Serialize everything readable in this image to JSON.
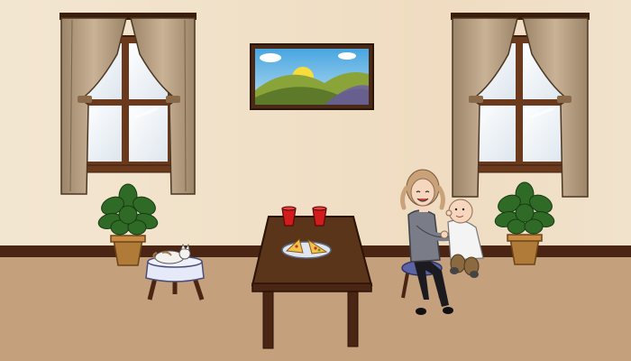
{
  "scene": {
    "description_free": true,
    "objects": [
      {
        "name": "window-left"
      },
      {
        "name": "window-right"
      },
      {
        "name": "landscape-painting"
      },
      {
        "name": "potted-plant-left"
      },
      {
        "name": "potted-plant-right"
      },
      {
        "name": "side-table-with-cat"
      },
      {
        "name": "dining-table"
      },
      {
        "name": "red-cups"
      },
      {
        "name": "pizza-plate"
      },
      {
        "name": "woman-holding-baby"
      }
    ]
  },
  "colors": {
    "wall": "#f1e1c9",
    "baseboard": "#4a2513",
    "floor": "#c4a07d",
    "wood": "#5b3519",
    "curtain": "#b59d82",
    "plant": "#2f6b26",
    "pot": "#b07a38",
    "cup": "#d21b1b",
    "shirt": "#7a7d87",
    "hair": "#c9a27a"
  }
}
